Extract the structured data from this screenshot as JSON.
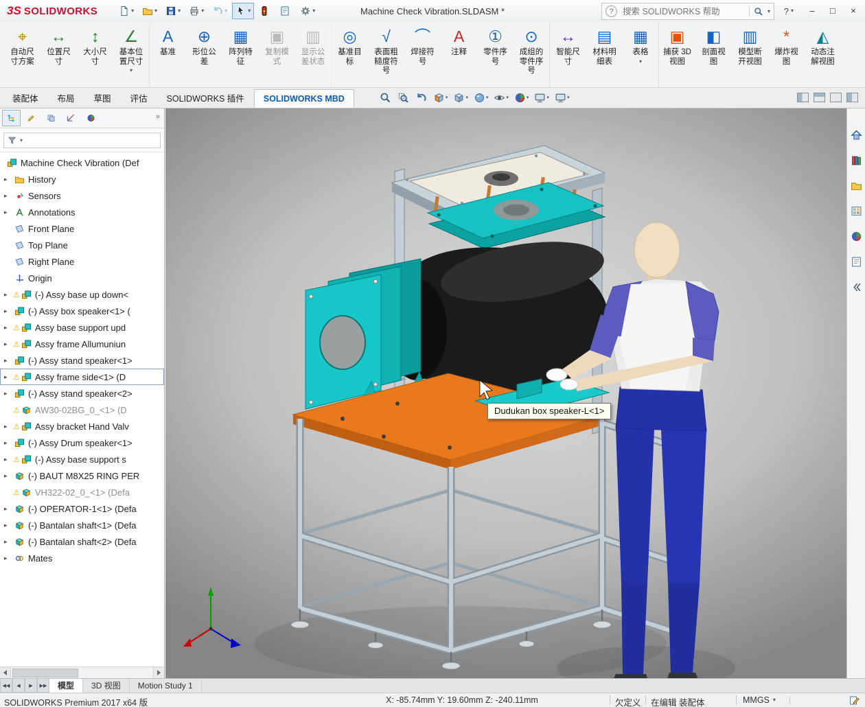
{
  "titlebar": {
    "logo": {
      "mark": "3S",
      "name": "SOLIDWORKS"
    },
    "doc_title": "Machine Check Vibration.SLDASM *",
    "quick_tools": [
      {
        "name": "new-document",
        "icon": "#sym-doc",
        "caret": "▾",
        "cls": ""
      },
      {
        "name": "open",
        "icon": "#sym-folder",
        "caret": "▾",
        "cls": ""
      },
      {
        "name": "save",
        "icon": "#sym-disk",
        "caret": "▾",
        "cls": ""
      },
      {
        "name": "print",
        "icon": "#sym-printer",
        "caret": "▾",
        "cls": ""
      },
      {
        "name": "undo",
        "icon": "#sym-undo",
        "caret": "▾",
        "cls": "disabled"
      },
      {
        "name": "select",
        "icon": "#sym-cursor",
        "caret": "▾",
        "cls": "pressed"
      },
      {
        "name": "rebuild",
        "icon": "#sym-rebuild",
        "caret": "",
        "cls": ""
      },
      {
        "name": "file-properties",
        "icon": "#sym-sheet",
        "caret": "",
        "cls": ""
      },
      {
        "name": "options",
        "icon": "#sym-gear",
        "caret": "▾",
        "cls": ""
      }
    ],
    "search": {
      "placeholder": "搜索 SOLIDWORKS 帮助",
      "help_glyph": "?",
      "caret": "▾"
    },
    "help_glyph": "?",
    "help_caret": "▾",
    "win": {
      "min": "–",
      "max": "□",
      "close": "×"
    }
  },
  "ribbon": {
    "items": [
      {
        "label": "自动尺寸方案",
        "glyph": "⌖",
        "color": "#b58900",
        "caret": "",
        "cls": ""
      },
      {
        "label": "位置尺寸",
        "glyph": "↔",
        "color": "#2e7d32",
        "caret": "",
        "cls": ""
      },
      {
        "label": "大小尺寸",
        "glyph": "↕",
        "color": "#2e7d32",
        "caret": "",
        "cls": ""
      },
      {
        "label": "基本位置尺寸",
        "glyph": "∠",
        "color": "#2e7d32",
        "caret": "▾",
        "cls": ""
      },
      {
        "label": "基准",
        "glyph": "A",
        "color": "#1565c0",
        "caret": "",
        "cls": ""
      },
      {
        "label": "形位公差",
        "glyph": "⊕",
        "color": "#1565c0",
        "caret": "",
        "cls": ""
      },
      {
        "label": "阵列特征",
        "glyph": "▦",
        "color": "#1565c0",
        "caret": "",
        "cls": ""
      },
      {
        "label": "复制模式",
        "glyph": "▣",
        "color": "#777777",
        "caret": "",
        "cls": "disabled"
      },
      {
        "label": "显示公差状态",
        "glyph": "▥",
        "color": "#777777",
        "caret": "",
        "cls": "disabled"
      },
      {
        "label": "基准目标",
        "glyph": "◎",
        "color": "#1565c0",
        "caret": "",
        "cls": ""
      },
      {
        "label": "表面粗糙度符号",
        "glyph": "√",
        "color": "#1565c0",
        "caret": "",
        "cls": ""
      },
      {
        "label": "焊接符号",
        "glyph": "⌒",
        "color": "#1565c0",
        "caret": "",
        "cls": ""
      },
      {
        "label": "注释",
        "glyph": "A",
        "color": "#c62828",
        "caret": "",
        "cls": ""
      },
      {
        "label": "零件序号",
        "glyph": "①",
        "color": "#1565c0",
        "caret": "",
        "cls": ""
      },
      {
        "label": "成组的零件序号",
        "glyph": "⊙",
        "color": "#1565c0",
        "caret": "",
        "cls": ""
      },
      {
        "label": "智能尺寸",
        "glyph": "↔",
        "color": "#6a1fb0",
        "caret": "",
        "cls": ""
      },
      {
        "label": "材料明细表",
        "glyph": "▤",
        "color": "#1565c0",
        "caret": "",
        "cls": ""
      },
      {
        "label": "表格",
        "glyph": "▦",
        "color": "#1565c0",
        "caret": "▾",
        "cls": ""
      },
      {
        "label": "捕获 3D 视图",
        "glyph": "▣",
        "color": "#e65100",
        "caret": "",
        "cls": ""
      },
      {
        "label": "剖面视图",
        "glyph": "◧",
        "color": "#1565c0",
        "caret": "",
        "cls": ""
      },
      {
        "label": "模型断开视图",
        "glyph": "▥",
        "color": "#1565c0",
        "caret": "",
        "cls": ""
      },
      {
        "label": "爆炸视图",
        "glyph": "*",
        "color": "#e65100",
        "caret": "",
        "cls": ""
      },
      {
        "label": "动态注解视图",
        "glyph": "◭",
        "color": "#00838f",
        "caret": "",
        "cls": ""
      }
    ]
  },
  "tabs": {
    "items": [
      {
        "label": "装配体",
        "cls": ""
      },
      {
        "label": "布局",
        "cls": ""
      },
      {
        "label": "草图",
        "cls": ""
      },
      {
        "label": "评估",
        "cls": ""
      },
      {
        "label": "SOLIDWORKS 插件",
        "cls": ""
      },
      {
        "label": "SOLIDWORKS MBD",
        "cls": "active"
      }
    ]
  },
  "headsup": {
    "items": [
      {
        "name": "zoom-fit",
        "icon": "#sym-magnifier",
        "caret": ""
      },
      {
        "name": "zoom-area",
        "icon": "#sym-magnifier-area",
        "caret": ""
      },
      {
        "name": "previous-view",
        "icon": "#sym-undo",
        "caret": ""
      },
      {
        "name": "section-view",
        "icon": "#sym-section",
        "caret": "▾"
      },
      {
        "name": "view-orientation",
        "icon": "#sym-cube",
        "caret": "▾"
      },
      {
        "name": "display-style",
        "icon": "#sym-sphere",
        "caret": "▾"
      },
      {
        "name": "hide-show-items",
        "icon": "#sym-eye",
        "caret": "▾"
      },
      {
        "name": "edit-appearance",
        "icon": "#sym-ball",
        "caret": "▾"
      },
      {
        "name": "apply-scene",
        "icon": "#sym-monitor",
        "caret": "▾"
      },
      {
        "name": "view-settings",
        "icon": "#sym-monitor",
        "caret": "▾"
      }
    ]
  },
  "panel": {
    "more_glyph": "»",
    "tabs": [
      {
        "name": "featuremanager-tab",
        "icon": "#sym-tree",
        "cls": "active"
      },
      {
        "name": "propertymanager-tab",
        "icon": "#sym-prop",
        "cls": ""
      },
      {
        "name": "configurationmanager-tab",
        "icon": "#sym-config",
        "cls": ""
      },
      {
        "name": "dimxpertmanager-tab",
        "icon": "#sym-dimx",
        "cls": ""
      },
      {
        "name": "displaymanager-tab",
        "icon": "#sym-ball",
        "cls": ""
      }
    ],
    "tree": [
      {
        "label": "Machine Check Vibration (Def",
        "icon": "#sym-asm",
        "arrow": "",
        "warn": "",
        "classes": "root"
      },
      {
        "label": "History",
        "icon": "#sym-folder",
        "arrow": "▸",
        "warn": "",
        "classes": ""
      },
      {
        "label": "Sensors",
        "icon": "#sym-sensor",
        "arrow": "▸",
        "warn": "",
        "classes": ""
      },
      {
        "label": "Annotations",
        "icon": "#sym-annot",
        "arrow": "▸",
        "warn": "",
        "classes": ""
      },
      {
        "label": "Front Plane",
        "icon": "#sym-plane",
        "arrow": "",
        "warn": "",
        "classes": ""
      },
      {
        "label": "Top Plane",
        "icon": "#sym-plane",
        "arrow": "",
        "warn": "",
        "classes": ""
      },
      {
        "label": "Right Plane",
        "icon": "#sym-plane",
        "arrow": "",
        "warn": "",
        "classes": ""
      },
      {
        "label": "Origin",
        "icon": "#sym-origin",
        "arrow": "",
        "warn": "",
        "classes": ""
      },
      {
        "label": "(-) Assy base up down<",
        "icon": "#sym-asm",
        "arrow": "▸",
        "warn": "⚠",
        "classes": ""
      },
      {
        "label": "(-) Assy box speaker<1> (",
        "icon": "#sym-asm",
        "arrow": "▸",
        "warn": "",
        "classes": ""
      },
      {
        "label": "Assy base support upd",
        "icon": "#sym-asm",
        "arrow": "▸",
        "warn": "⚠",
        "classes": ""
      },
      {
        "label": "Assy frame Allumuniun",
        "icon": "#sym-asm",
        "arrow": "▸",
        "warn": "⚠",
        "classes": ""
      },
      {
        "label": "(-) Assy stand speaker<1>",
        "icon": "#sym-asm",
        "arrow": "▸",
        "warn": "",
        "classes": ""
      },
      {
        "label": "Assy frame side<1> (D",
        "icon": "#sym-asm",
        "arrow": "▸",
        "warn": "⚠",
        "classes": "selected"
      },
      {
        "label": "(-) Assy stand speaker<2>",
        "icon": "#sym-asm",
        "arrow": "▸",
        "warn": "",
        "classes": ""
      },
      {
        "label": "AW30-02BG_0_<1> (D",
        "icon": "#sym-part",
        "arrow": "",
        "warn": "⚠",
        "classes": "gray"
      },
      {
        "label": "Assy bracket Hand Valv",
        "icon": "#sym-asm",
        "arrow": "▸",
        "warn": "⚠",
        "classes": ""
      },
      {
        "label": "(-) Assy Drum speaker<1>",
        "icon": "#sym-asm",
        "arrow": "▸",
        "warn": "",
        "classes": ""
      },
      {
        "label": "(-) Assy base support s",
        "icon": "#sym-asm",
        "arrow": "▸",
        "warn": "⚠",
        "classes": ""
      },
      {
        "label": "(-) BAUT M8X25 RING PER",
        "icon": "#sym-part",
        "arrow": "▸",
        "warn": "",
        "classes": ""
      },
      {
        "label": "VH322-02_0_<1> (Defa",
        "icon": "#sym-part",
        "arrow": "",
        "warn": "⚠",
        "classes": "gray"
      },
      {
        "label": "(-) OPERATOR-1<1> (Defa",
        "icon": "#sym-part",
        "arrow": "▸",
        "warn": "",
        "classes": ""
      },
      {
        "label": "(-) Bantalan shaft<1> (Defa",
        "icon": "#sym-part",
        "arrow": "▸",
        "warn": "",
        "classes": ""
      },
      {
        "label": "(-) Bantalan shaft<2> (Defa",
        "icon": "#sym-part",
        "arrow": "▸",
        "warn": "",
        "classes": ""
      },
      {
        "label": "Mates",
        "icon": "#sym-mate",
        "arrow": "▸",
        "warn": "",
        "classes": ""
      }
    ]
  },
  "viewport": {
    "tooltip": "Dudukan box speaker-L<1>",
    "selection_color": "#ff7a00"
  },
  "task_pane": {
    "items": [
      {
        "name": "solidworks-resources",
        "icon": "#sym-home"
      },
      {
        "name": "design-library",
        "icon": "#sym-books"
      },
      {
        "name": "file-explorer",
        "icon": "#sym-folder"
      },
      {
        "name": "view-palette",
        "icon": "#sym-viewpal"
      },
      {
        "name": "appearances-scenes",
        "icon": "#sym-ball"
      },
      {
        "name": "custom-properties",
        "icon": "#sym-list"
      },
      {
        "name": "pane-collapse",
        "icon": "#sym-chevrons"
      }
    ]
  },
  "bottom": {
    "nav": [
      {
        "g": "◀◀"
      },
      {
        "g": "◀"
      },
      {
        "g": "▶"
      },
      {
        "g": "▶▶"
      }
    ],
    "tabs": [
      {
        "label": "模型",
        "cls": "active"
      },
      {
        "label": "3D 视图",
        "cls": ""
      },
      {
        "label": "Motion Study 1",
        "cls": ""
      }
    ]
  },
  "status": {
    "product": "SOLIDWORKS Premium 2017 x64 版",
    "coords": "X: -85.74mm Y: 19.60mm Z: -240.11mm",
    "state": "欠定义",
    "editing": "在编辑 装配体",
    "units": "MMGS",
    "units_caret": "▾"
  }
}
